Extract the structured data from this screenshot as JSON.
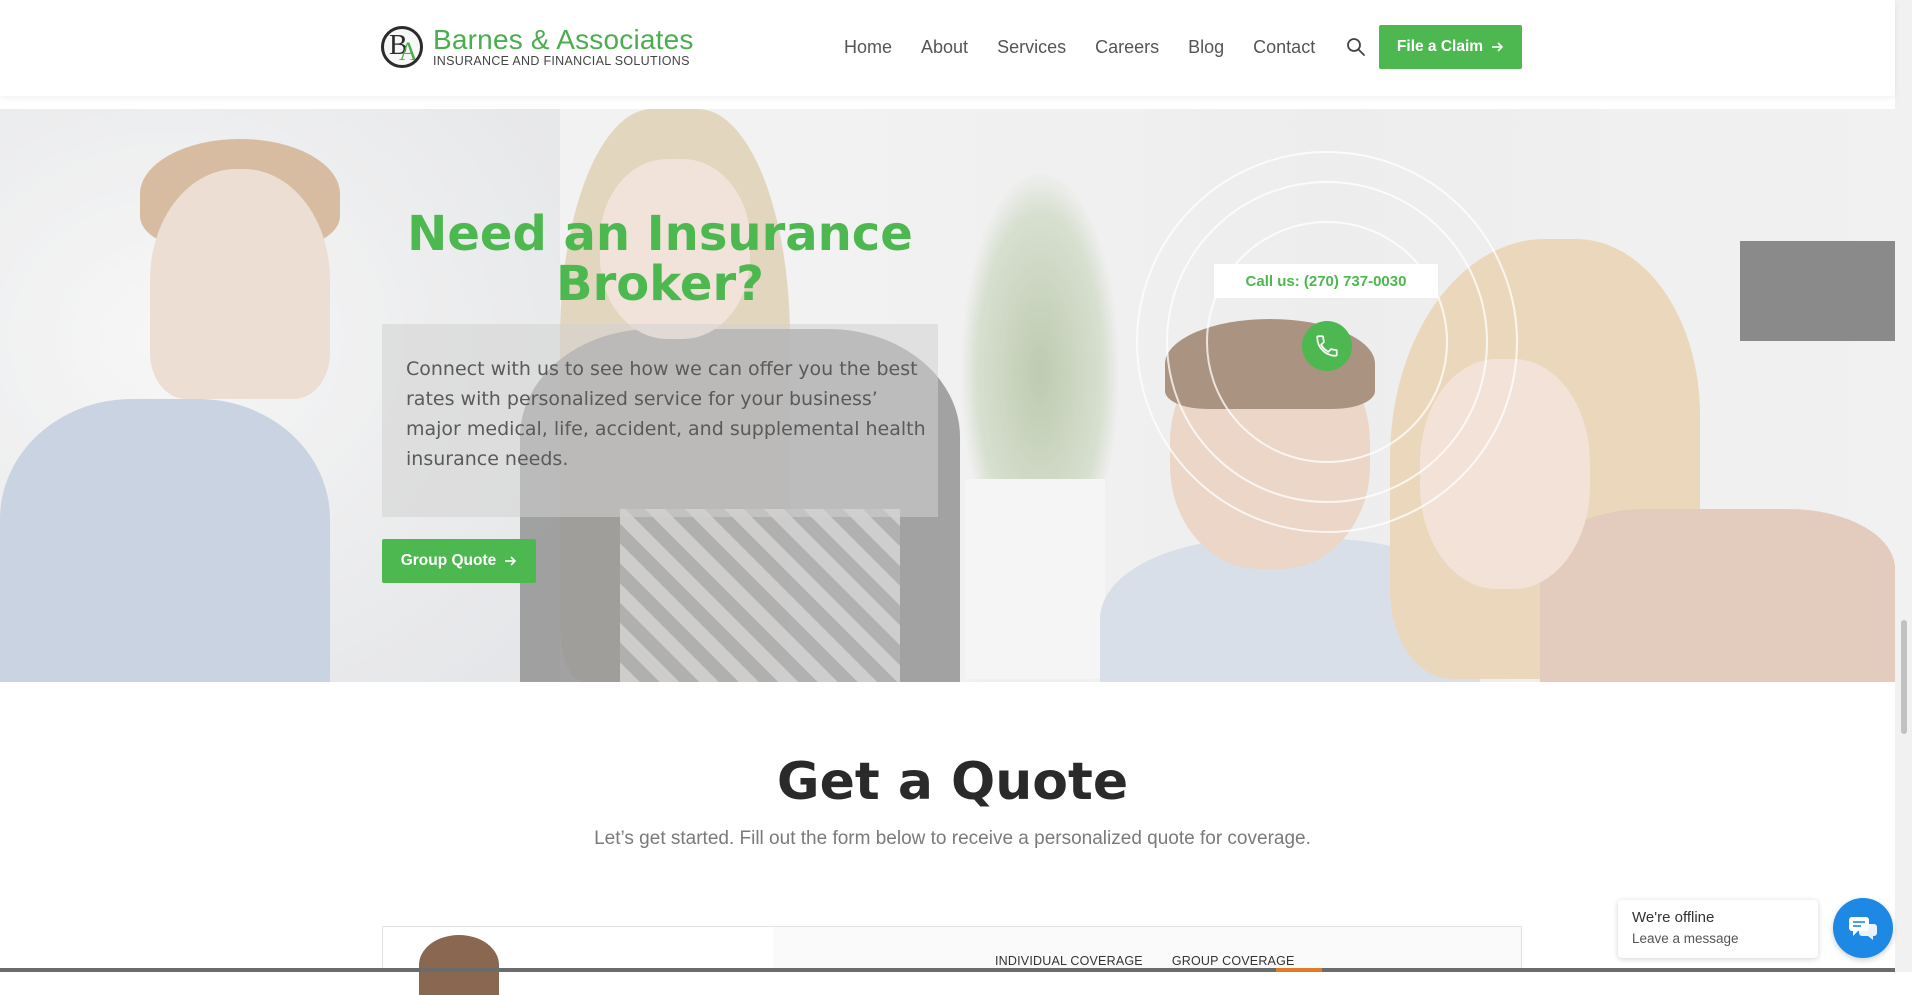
{
  "header": {
    "logo_name": "Barnes & Associates",
    "logo_tagline": "INSURANCE AND FINANCIAL SOLUTIONS",
    "nav": [
      {
        "label": "Home"
      },
      {
        "label": "About"
      },
      {
        "label": "Services"
      },
      {
        "label": "Careers"
      },
      {
        "label": "Blog"
      },
      {
        "label": "Contact"
      }
    ],
    "cta_label": "File a Claim"
  },
  "hero": {
    "title": "Need an Insurance Broker?",
    "body": "Connect with us to see how we can offer you the best rates with personalized service for your business’ major medical, life, accident, and supplemental health insurance needs.",
    "button_label": "Group Quote",
    "call_label": "Call us: (270) 737-0030"
  },
  "quote_section": {
    "title": "Get a Quote",
    "subtitle": "Let’s get started. Fill out the form below to receive a personalized quote for coverage.",
    "tabs": [
      {
        "label": "INDIVIDUAL COVERAGE"
      },
      {
        "label": "GROUP COVERAGE"
      }
    ]
  },
  "chat": {
    "status": "We're offline",
    "action": "Leave a message"
  },
  "colors": {
    "accent": "#4cb84f",
    "chat": "#1e88e5",
    "heading": "#2a2a2a"
  },
  "icons": {
    "search": "search-icon",
    "arrow": "arrow-right-icon",
    "phone": "phone-icon",
    "chat": "chat-icon"
  }
}
